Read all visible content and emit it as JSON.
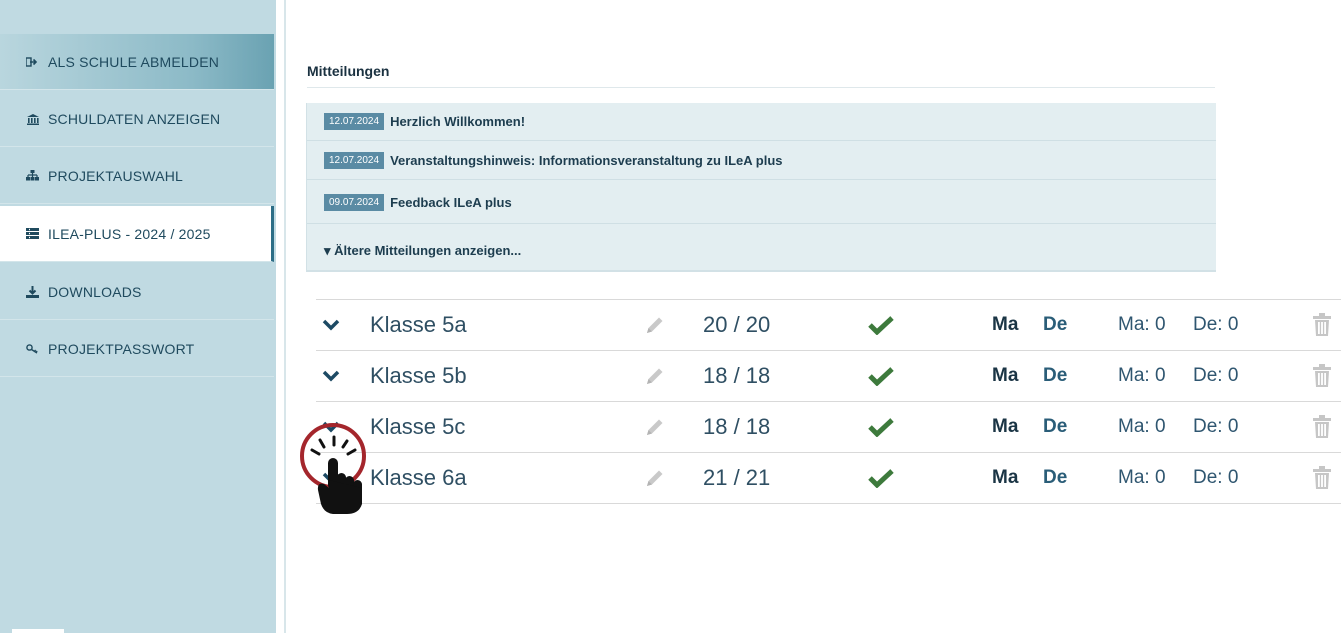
{
  "sidebar": {
    "items": [
      {
        "label": "ALS SCHULE ABMELDEN",
        "icon": "sign-out-icon"
      },
      {
        "label": "SCHULDATEN ANZEIGEN",
        "icon": "institution-icon"
      },
      {
        "label": "PROJEKTAUSWAHL",
        "icon": "sitemap-icon"
      },
      {
        "label": "ILEA-PLUS - 2024 / 2025",
        "icon": "list-icon",
        "active": true
      },
      {
        "label": "DOWNLOADS",
        "icon": "download-icon"
      },
      {
        "label": "PROJEKTPASSWORT",
        "icon": "key-icon"
      }
    ]
  },
  "messages": {
    "heading": "Mitteilungen",
    "items": [
      {
        "date": "12.07.2024",
        "title": "Herzlich Willkommen!"
      },
      {
        "date": "12.07.2024",
        "title": "Veranstaltungshinweis: Informationsveranstaltung zu ILeA plus"
      },
      {
        "date": "09.07.2024",
        "title": "Feedback ILeA plus"
      }
    ],
    "more_link": "▾ Ältere Mitteilungen anzeigen..."
  },
  "classes": [
    {
      "name": "Klasse 5a",
      "count": "20 / 20",
      "subject_ma": "Ma",
      "subject_de": "De",
      "score_ma": "Ma: 0",
      "score_de": "De: 0"
    },
    {
      "name": "Klasse 5b",
      "count": "18 / 18",
      "subject_ma": "Ma",
      "subject_de": "De",
      "score_ma": "Ma: 0",
      "score_de": "De: 0"
    },
    {
      "name": "Klasse 5c",
      "count": "18 / 18",
      "subject_ma": "Ma",
      "subject_de": "De",
      "score_ma": "Ma: 0",
      "score_de": "De: 0"
    },
    {
      "name": "Klasse 6a",
      "count": "21 / 21",
      "subject_ma": "Ma",
      "subject_de": "De",
      "score_ma": "Ma: 0",
      "score_de": "De: 0"
    }
  ],
  "colors": {
    "sidebar_bg": "#c0dae2",
    "accent": "#2c6d86",
    "check": "#3d7a3c",
    "date_badge": "#5a8ba4",
    "click_ring": "#a4262c"
  }
}
